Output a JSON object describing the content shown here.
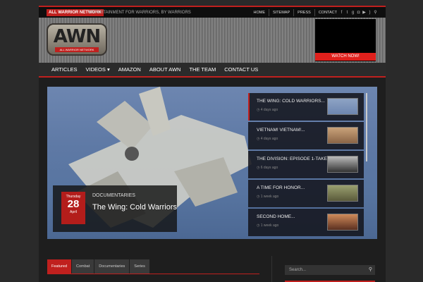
{
  "topbar": {
    "site_badge": "ALL WARRIOR NETWORK",
    "tagline": "ENTERTAINMENT FOR WARRIORS, BY WARRIORS",
    "links": [
      "HOME",
      "SITEMAP",
      "PRESS",
      "CONTACT"
    ],
    "social_icons": [
      "facebook-icon",
      "twitter-icon",
      "googleplus-icon",
      "instagram-icon",
      "youtube-icon",
      "rss-icon",
      "search-icon"
    ]
  },
  "header": {
    "logo_text": "AWN",
    "logo_sub": "ALL WARRIOR NETWORK",
    "watch_label": "WATCH NOW!"
  },
  "nav": {
    "items": [
      "ARTICLES",
      "VIDEOS ▾",
      "AMAZON",
      "ABOUT AWN",
      "THE TEAM",
      "CONTACT US"
    ]
  },
  "feature": {
    "day_name": "Thursday",
    "day": "28",
    "month": "April",
    "category": "DOCUMENTARIES",
    "title": "The Wing: Cold Warriors"
  },
  "slides": [
    {
      "title": "THE WING: COLD WARRIORS...",
      "time": "4 days ago"
    },
    {
      "title": "VIETNAM! VIETNAM!...",
      "time": "4 days ago"
    },
    {
      "title": "THE DIVISION: EPISODE 1-TAKEN...",
      "time": "6 days ago"
    },
    {
      "title": "A TIME FOR HONOR...",
      "time": "1 week ago"
    },
    {
      "title": "SECOND HOME...",
      "time": "1 week ago"
    }
  ],
  "tabs": [
    "Featured",
    "Combat",
    "Documentaries",
    "Series"
  ],
  "search": {
    "placeholder": "Search..."
  },
  "colors": {
    "accent": "#c0201e",
    "background": "#2a2a2a"
  }
}
